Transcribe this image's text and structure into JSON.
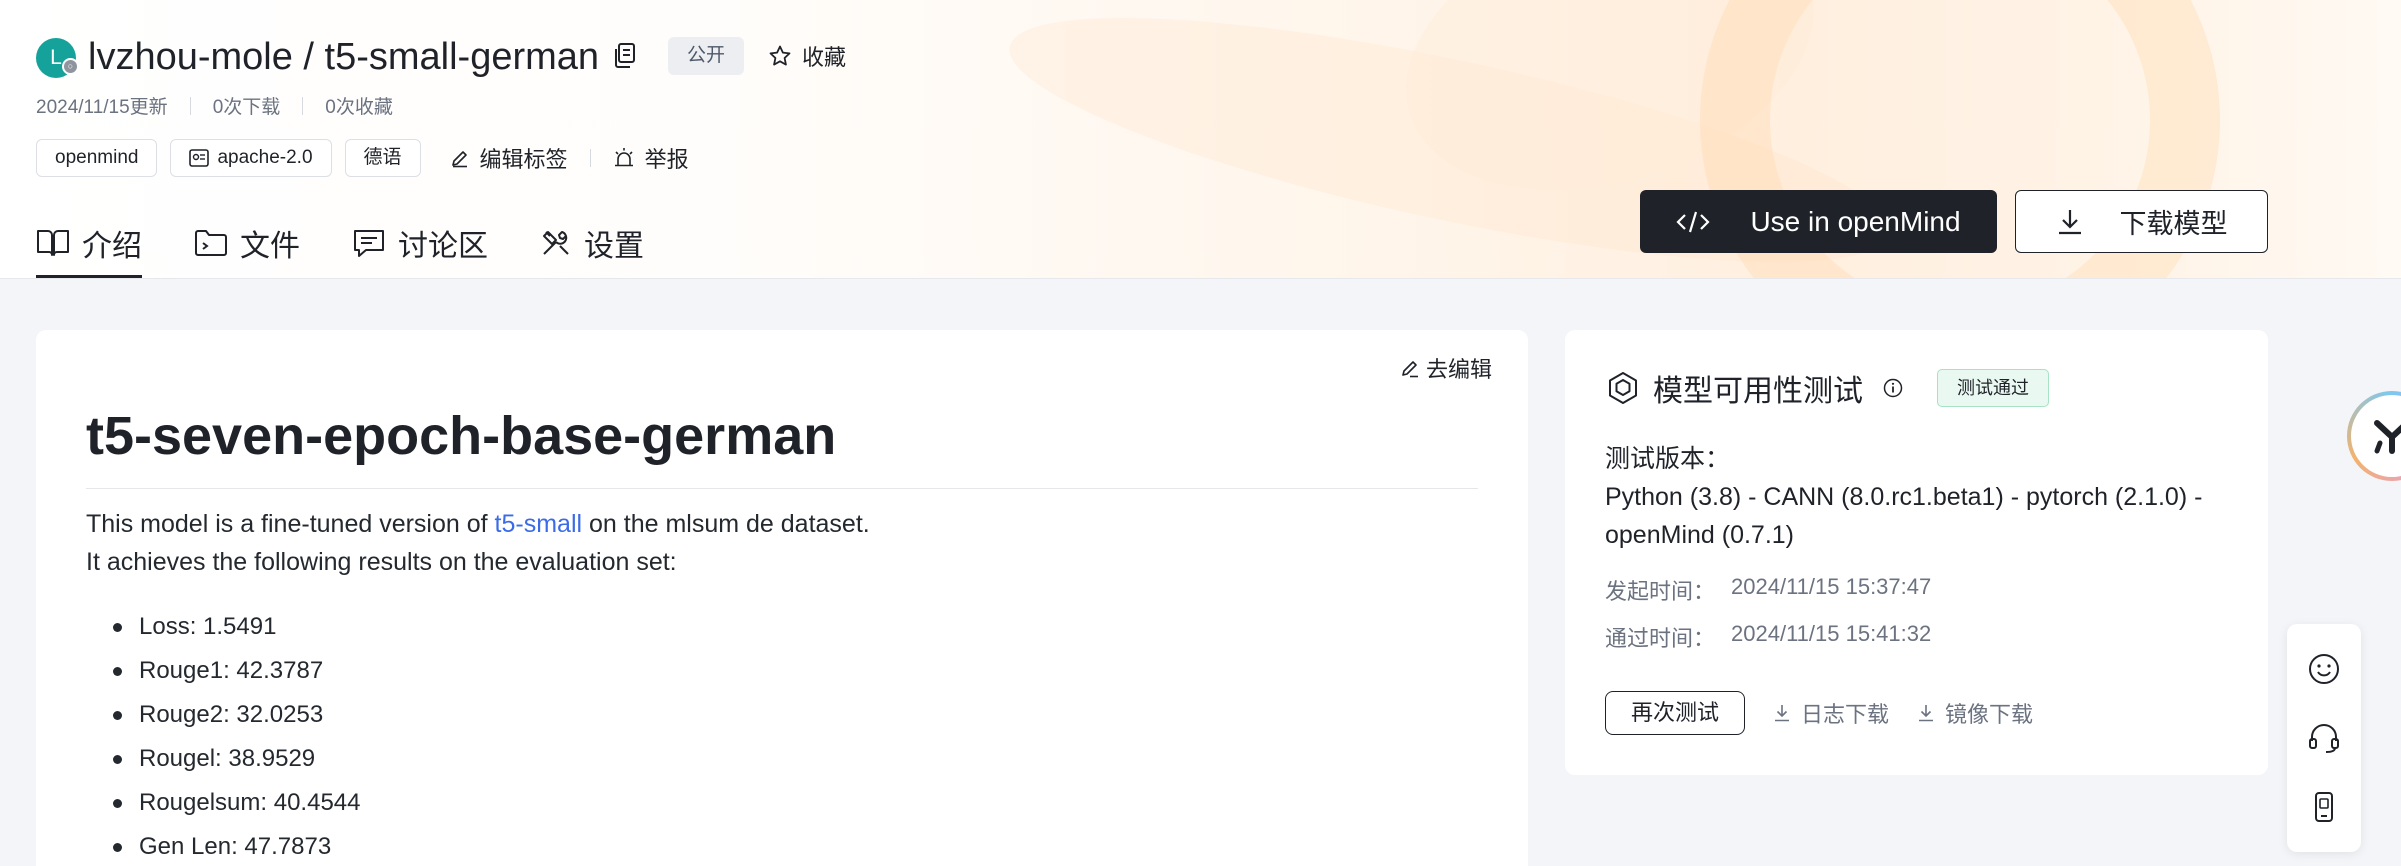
{
  "repo": {
    "avatar_letter": "L",
    "avatar_badge": "○",
    "title": "lvzhou-mole / t5-small-german",
    "visibility": "公开",
    "favorite_label": "收藏",
    "updated": "2024/11/15更新",
    "downloads": "0次下载",
    "favorites": "0次收藏"
  },
  "tags": {
    "items": [
      "openmind",
      "apache-2.0",
      "德语"
    ],
    "edit_label": "编辑标签",
    "report_label": "举报"
  },
  "tabs": [
    "介绍",
    "文件",
    "讨论区",
    "设置"
  ],
  "actions": {
    "openmind_label": "Use in openMind",
    "download_label": "下载模型"
  },
  "readme": {
    "edit_label": "去编辑",
    "heading": "t5-seven-epoch-base-german",
    "intro_before": "This model is a fine-tuned version of ",
    "intro_link": "t5-small",
    "intro_after": " on the mlsum de dataset.",
    "intro_line2": "It achieves the following results on the evaluation set:",
    "results": [
      "Loss: 1.5491",
      "Rouge1: 42.3787",
      "Rouge2: 32.0253",
      "Rougel: 38.9529",
      "Rougelsum: 40.4544",
      "Gen Len: 47.7873"
    ]
  },
  "test": {
    "title": "模型可用性测试",
    "status": "测试通过",
    "version_label": "测试版本：",
    "version_value": "Python (3.8) - CANN (8.0.rc1.beta1) - pytorch (2.1.0) - openMind (0.7.1)",
    "start_label": "发起时间：",
    "start_value": "2024/11/15 15:37:47",
    "pass_label": "通过时间：",
    "pass_value": "2024/11/15 15:41:32",
    "retest_label": "再次测试",
    "log_download_label": "日志下载",
    "image_download_label": "镜像下载"
  },
  "colors": {
    "primary_dark": "#1f2329",
    "link_blue": "#3b6ce7",
    "pass_green": "#e9f8f0"
  }
}
